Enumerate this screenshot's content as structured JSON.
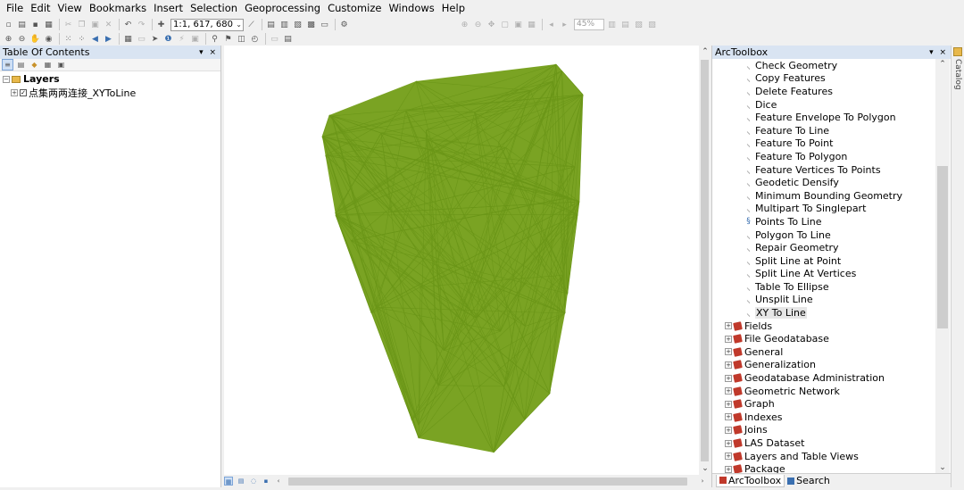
{
  "menu": [
    "File",
    "Edit",
    "View",
    "Bookmarks",
    "Insert",
    "Selection",
    "Geoprocessing",
    "Customize",
    "Windows",
    "Help"
  ],
  "toolbar": {
    "scale": "1:1, 617, 680",
    "zoom_percent": "45%"
  },
  "toc": {
    "title": "Table Of Contents",
    "controls": "▾ ×",
    "root_label": "Layers",
    "layer_label": "点集两两连接_XYToLine"
  },
  "arctoolbox": {
    "title": "ArcToolbox",
    "controls": "▾ ×",
    "tools": [
      {
        "label": "Check Geometry",
        "icon": "hammer-icon"
      },
      {
        "label": "Copy Features",
        "icon": "hammer-icon"
      },
      {
        "label": "Delete Features",
        "icon": "hammer-icon"
      },
      {
        "label": "Dice",
        "icon": "hammer-icon"
      },
      {
        "label": "Feature Envelope To Polygon",
        "icon": "hammer-icon"
      },
      {
        "label": "Feature To Line",
        "icon": "hammer-icon"
      },
      {
        "label": "Feature To Point",
        "icon": "hammer-icon"
      },
      {
        "label": "Feature To Polygon",
        "icon": "hammer-icon"
      },
      {
        "label": "Feature Vertices To Points",
        "icon": "hammer-icon"
      },
      {
        "label": "Geodetic Densify",
        "icon": "hammer-icon"
      },
      {
        "label": "Minimum Bounding Geometry",
        "icon": "hammer-icon"
      },
      {
        "label": "Multipart To Singlepart",
        "icon": "hammer-icon"
      },
      {
        "label": "Points To Line",
        "icon": "script-icon"
      },
      {
        "label": "Polygon To Line",
        "icon": "hammer-icon"
      },
      {
        "label": "Repair Geometry",
        "icon": "hammer-icon"
      },
      {
        "label": "Split Line at Point",
        "icon": "hammer-icon"
      },
      {
        "label": "Split Line At Vertices",
        "icon": "hammer-icon"
      },
      {
        "label": "Table To Ellipse",
        "icon": "hammer-icon"
      },
      {
        "label": "Unsplit Line",
        "icon": "hammer-icon"
      },
      {
        "label": "XY To Line",
        "icon": "hammer-icon",
        "selected": true
      }
    ],
    "toolsets": [
      "Fields",
      "File Geodatabase",
      "General",
      "Generalization",
      "Geodatabase Administration",
      "Geometric Network",
      "Graph",
      "Indexes",
      "Joins",
      "LAS Dataset",
      "Layers and Table Views",
      "Package"
    ],
    "tabs": [
      "ArcToolbox",
      "Search"
    ]
  },
  "catalog_tab": "Catalog",
  "colors": {
    "line_fill": "#7aa323",
    "line_stroke": "#6b9618",
    "panel_title": "#d9e4f2"
  }
}
